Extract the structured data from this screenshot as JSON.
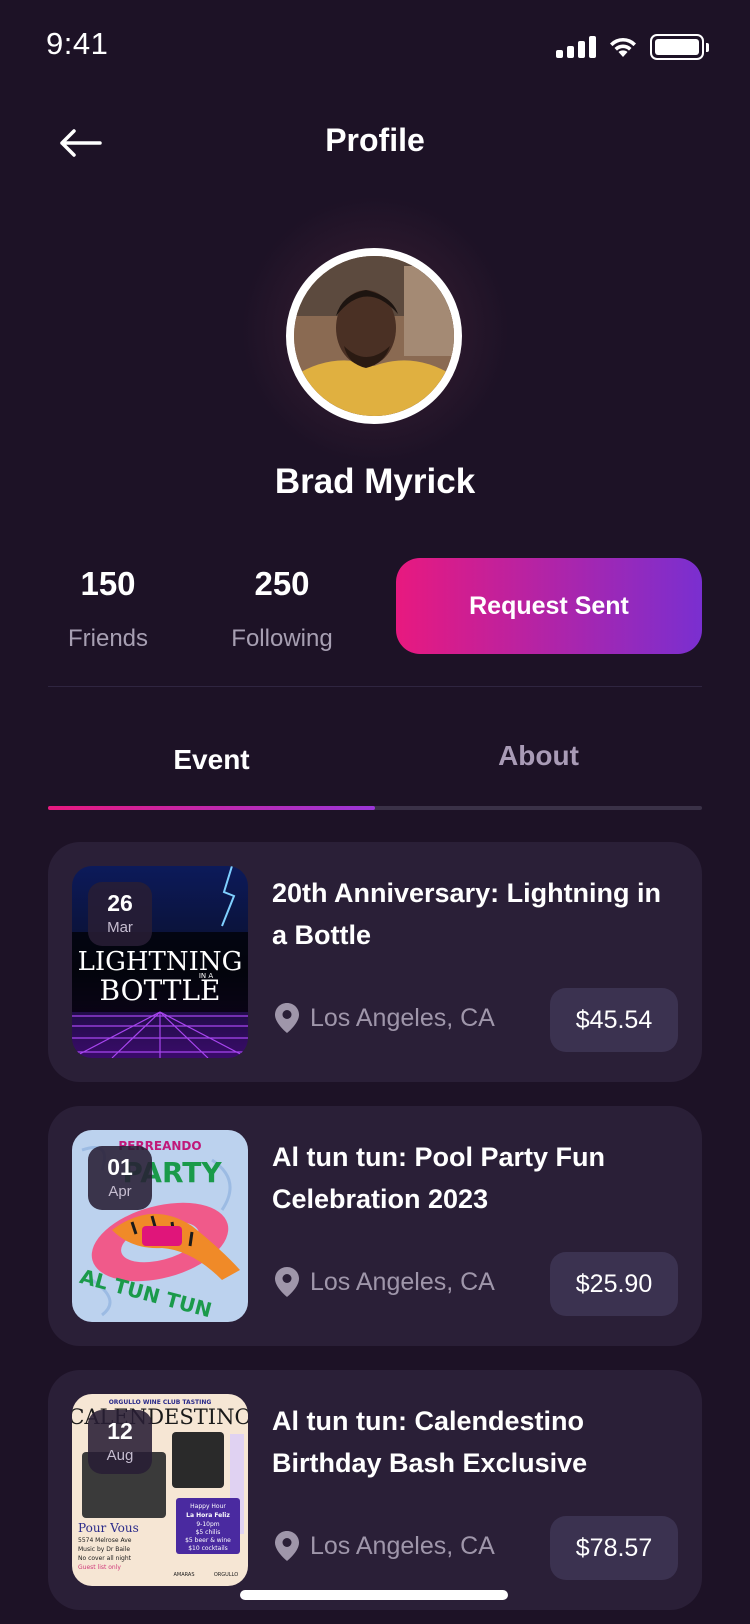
{
  "status_bar": {
    "time": "9:41"
  },
  "header": {
    "title": "Profile"
  },
  "profile": {
    "name": "Brad Myrick",
    "stats": [
      {
        "value": "150",
        "label": "Friends"
      },
      {
        "value": "250",
        "label": "Following"
      }
    ],
    "action_label": "Request Sent"
  },
  "tabs": [
    {
      "label": "Event",
      "active": true
    },
    {
      "label": "About",
      "active": false
    }
  ],
  "events": [
    {
      "day": "26",
      "month": "Mar",
      "title": "20th Anniversary: Lightning in a Bottle",
      "location": "Los Angeles, CA",
      "price": "$45.54",
      "image_text": [
        "LIGHTNING",
        "IN A",
        "BOTTLE"
      ]
    },
    {
      "day": "01",
      "month": "Apr",
      "title": "Al tun tun: Pool Party Fun Celebration 2023",
      "location": "Los Angeles, CA",
      "price": "$25.90",
      "image_text": [
        "PERREANDO",
        "PARTY",
        "AL TUN TUN"
      ]
    },
    {
      "day": "12",
      "month": "Aug",
      "title": "Al tun tun: Calendestino Birthday Bash Exclusive",
      "location": "Los Angeles, CA",
      "price": "$78.57",
      "image_text": [
        "ORGULLO WINE CLUB TASTING",
        "CALENDESTINO",
        "Pour Vous",
        "5574 Melrose Ave",
        "Music by Dr Baile",
        "No cover all night",
        "Guest list only",
        "Happy Hour",
        "La Hora Feliz",
        "9-10pm",
        "$5 chilis",
        "$5 beer & wine",
        "$10 cocktails",
        "AMARAS",
        "ORGULLO"
      ]
    }
  ],
  "colors": {
    "background": "#1d1226",
    "card": "#2a1f37",
    "accent_start": "#e8197f",
    "accent_end": "#7a2fd0",
    "muted_text": "#a79fb2"
  }
}
